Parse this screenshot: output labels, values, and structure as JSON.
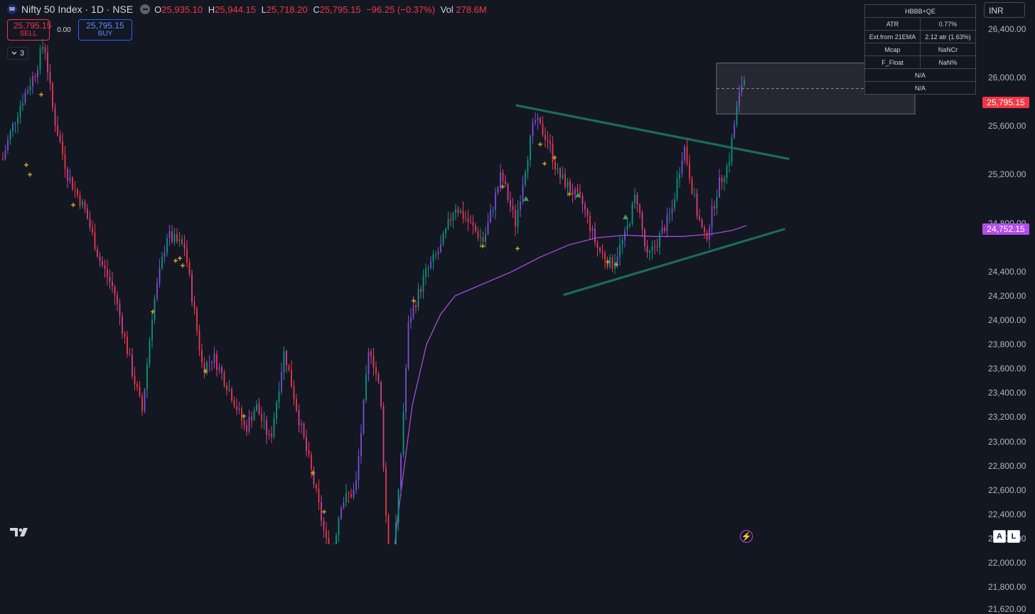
{
  "symbol": {
    "badge": "50",
    "title": "Nifty 50 Index · 1D · NSE",
    "open_key": "O",
    "open": "25,935.10",
    "high_key": "H",
    "high": "25,944.15",
    "low_key": "L",
    "low": "25,718.20",
    "close_key": "C",
    "close": "25,795.15",
    "change": "−96.25 (−0.37%)",
    "vol_key": "Vol",
    "vol": "278.6M"
  },
  "trade": {
    "sell_price": "25,795.15",
    "sell_label": "SELL",
    "spread": "0.00",
    "buy_price": "25,795.15",
    "buy_label": "BUY"
  },
  "indicators_count": "3",
  "currency": "INR",
  "price_axis": {
    "ticks": [
      "26,400.00",
      "26,000.00",
      "25,600.00",
      "25,200.00",
      "24,800.00",
      "24,400.00",
      "24,200.00",
      "24,000.00",
      "23,800.00",
      "23,600.00",
      "23,400.00",
      "23,200.00",
      "23,000.00",
      "22,800.00",
      "22,600.00",
      "22,400.00",
      "22,200.00",
      "22,000.00",
      "21,800.00",
      "21,620.00"
    ],
    "last_price": "25,795.15",
    "ma_price": "24,752.15"
  },
  "colors": {
    "background": "#131722",
    "up": "#089981",
    "down": "#f23645",
    "ma": "#b24ee8",
    "trendline": "#1c6b5e",
    "marker_plus": "#c9a227",
    "marker_triangle": "#3aa05a"
  },
  "info_table": {
    "title": "HBBB+QE",
    "rows": [
      {
        "label": "ATR",
        "value": "0.77%"
      },
      {
        "label": "Ext.from 21EMA",
        "value": "2.12 atr (1.63%)"
      },
      {
        "label": "Mcap",
        "value": "NaNCr"
      },
      {
        "label": "F_Float",
        "value": "NaN%"
      }
    ],
    "full_rows": [
      "N/A",
      "N/A"
    ]
  },
  "bottom": {
    "logo_icon": "tradingview-logo",
    "bolt_icon": "lightning-icon",
    "auto_label": "A",
    "log_label": "L"
  },
  "chart_data": {
    "type": "candlestick",
    "title": "Nifty 50 Index · 1D · NSE",
    "y_range": [
      21620,
      26500
    ],
    "price_key": [
      [
        0,
        25250
      ],
      [
        12,
        25500
      ],
      [
        30,
        25800
      ],
      [
        50,
        26050
      ],
      [
        62,
        26300
      ],
      [
        75,
        25700
      ],
      [
        95,
        25200
      ],
      [
        120,
        24900
      ],
      [
        140,
        24500
      ],
      [
        160,
        24250
      ],
      [
        185,
        23600
      ],
      [
        200,
        23250
      ],
      [
        215,
        24100
      ],
      [
        235,
        24700
      ],
      [
        260,
        24600
      ],
      [
        270,
        24200
      ],
      [
        285,
        23600
      ],
      [
        300,
        23700
      ],
      [
        325,
        23400
      ],
      [
        345,
        23100
      ],
      [
        360,
        23300
      ],
      [
        380,
        23000
      ],
      [
        400,
        23750
      ],
      [
        420,
        23200
      ],
      [
        440,
        22700
      ],
      [
        465,
        22000
      ],
      [
        480,
        22500
      ],
      [
        500,
        22600
      ],
      [
        520,
        23800
      ],
      [
        535,
        23400
      ],
      [
        548,
        21750
      ],
      [
        560,
        22500
      ],
      [
        575,
        24000
      ],
      [
        600,
        24400
      ],
      [
        620,
        24600
      ],
      [
        640,
        24950
      ],
      [
        660,
        24800
      ],
      [
        680,
        24650
      ],
      [
        705,
        25200
      ],
      [
        725,
        24800
      ],
      [
        740,
        25300
      ],
      [
        752,
        25650
      ],
      [
        770,
        25500
      ],
      [
        785,
        25200
      ],
      [
        800,
        25100
      ],
      [
        820,
        24950
      ],
      [
        840,
        24600
      ],
      [
        860,
        24450
      ],
      [
        880,
        24700
      ],
      [
        895,
        25050
      ],
      [
        910,
        24500
      ],
      [
        925,
        24650
      ],
      [
        945,
        24900
      ],
      [
        962,
        25450
      ],
      [
        980,
        24900
      ],
      [
        992,
        24650
      ],
      [
        1010,
        25100
      ],
      [
        1025,
        25300
      ],
      [
        1035,
        25700
      ],
      [
        1042,
        25900
      ],
      [
        1046,
        26050
      ],
      [
        1050,
        25795
      ]
    ],
    "ma_key": [
      [
        548,
        21750
      ],
      [
        560,
        22400
      ],
      [
        580,
        23300
      ],
      [
        600,
        23800
      ],
      [
        620,
        24050
      ],
      [
        640,
        24200
      ],
      [
        680,
        24300
      ],
      [
        720,
        24400
      ],
      [
        760,
        24520
      ],
      [
        800,
        24620
      ],
      [
        840,
        24680
      ],
      [
        880,
        24700
      ],
      [
        920,
        24690
      ],
      [
        960,
        24690
      ],
      [
        1000,
        24710
      ],
      [
        1030,
        24740
      ],
      [
        1050,
        24780
      ]
    ],
    "series": [
      {
        "name": "MA",
        "values": "ma_key"
      }
    ],
    "trendlines": [
      {
        "from": [
          727,
          25770
        ],
        "to": [
          1109,
          25330
        ]
      },
      {
        "from": [
          794,
          24210
        ],
        "to": [
          1103,
          24750
        ]
      }
    ],
    "zone": {
      "x0": 1008,
      "x1": 1287,
      "y_top": 26120,
      "y_bottom": 25700,
      "mid": 25910
    },
    "plus_markers": [
      [
        37,
        25280
      ],
      [
        42,
        25200
      ],
      [
        58,
        25860
      ],
      [
        103,
        24950
      ],
      [
        215,
        24070
      ],
      [
        247,
        24490
      ],
      [
        253,
        24510
      ],
      [
        257,
        24450
      ],
      [
        289,
        23580
      ],
      [
        343,
        23210
      ],
      [
        440,
        22740
      ],
      [
        456,
        22420
      ],
      [
        582,
        24160
      ],
      [
        679,
        24610
      ],
      [
        707,
        25100
      ],
      [
        728,
        24590
      ],
      [
        760,
        25450
      ],
      [
        766,
        25290
      ],
      [
        780,
        25340
      ],
      [
        801,
        25040
      ],
      [
        855,
        24480
      ],
      [
        867,
        24460
      ]
    ],
    "triangle_markers": [
      [
        740,
        25000
      ],
      [
        813,
        25030
      ],
      [
        880,
        24850
      ]
    ]
  }
}
